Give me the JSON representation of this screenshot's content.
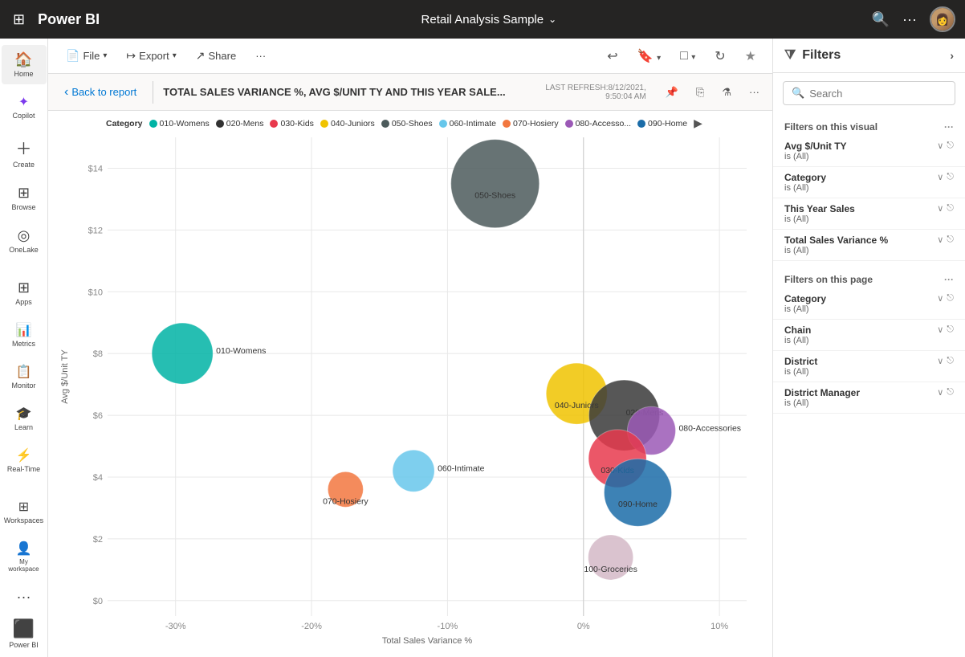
{
  "app": {
    "name": "Power BI",
    "grid_icon": "⊞",
    "nav_search_icon": "🔍",
    "nav_more_icon": "···"
  },
  "header": {
    "report_title": "Retail Analysis Sample",
    "chevron": "⌄",
    "last_refresh_label": "LAST REFRESH:8/12/2021,",
    "last_refresh_time": "9:50:04 AM"
  },
  "toolbar": {
    "file_label": "File",
    "export_label": "Export",
    "share_label": "Share",
    "more_label": "···",
    "undo_icon": "↩",
    "bookmark_icon": "🔖",
    "view_icon": "□",
    "refresh_icon": "↻",
    "favorite_icon": "★"
  },
  "report_header": {
    "back_label": "Back to report",
    "back_icon": "‹",
    "visual_title": "TOTAL SALES VARIANCE %, AVG $/UNIT TY AND THIS YEAR SALE..."
  },
  "legend": {
    "category_label": "Category",
    "items": [
      {
        "id": "010-Womens",
        "label": "010-Womens",
        "color": "#00B3A4"
      },
      {
        "id": "020-Mens",
        "label": "020-Mens",
        "color": "#333333"
      },
      {
        "id": "030-Kids",
        "label": "030-Kids",
        "color": "#E8394D"
      },
      {
        "id": "040-Juniors",
        "label": "040-Juniors",
        "color": "#F0C300"
      },
      {
        "id": "050-Shoes",
        "label": "050-Shoes",
        "color": "#4C5B5C"
      },
      {
        "id": "060-Intimate",
        "label": "060-Intimate",
        "color": "#67C7EB"
      },
      {
        "id": "070-Hosiery",
        "label": "070-Hosiery",
        "color": "#F2773F"
      },
      {
        "id": "080-Accesso...",
        "label": "080-Accesso...",
        "color": "#8B5CF6"
      },
      {
        "id": "090-Home",
        "label": "090-Home",
        "color": "#1B6CA8"
      }
    ],
    "more_icon": "▶"
  },
  "chart": {
    "x_axis_label": "Total Sales Variance %",
    "y_axis_label": "Avg $/Unit TY",
    "x_ticks": [
      "-30%",
      "-20%",
      "-10%",
      "0%",
      "10%"
    ],
    "y_ticks": [
      "$0",
      "$2",
      "$4",
      "$6",
      "$8",
      "$10",
      "$12",
      "$14"
    ],
    "bubbles": [
      {
        "id": "010-Womens",
        "label": "010-Womens",
        "color": "#00B3A4",
        "cx_pct": 6,
        "cy_pct": 42,
        "r": 38
      },
      {
        "id": "020-Mens",
        "label": "020-Mens",
        "color": "#3C3C3C",
        "cx_pct": 76,
        "cy_pct": 47,
        "r": 44
      },
      {
        "id": "030-Kids",
        "label": "030-Kids",
        "color": "#E8394D",
        "cx_pct": 72,
        "cy_pct": 56,
        "r": 36
      },
      {
        "id": "040-Juniors",
        "label": "040-Juniors",
        "color": "#F0C300",
        "cx_pct": 63,
        "cy_pct": 48,
        "r": 40
      },
      {
        "id": "050-Shoes",
        "label": "050-Shoes",
        "color": "#4C5B5C",
        "cx_pct": 68,
        "cy_pct": 12,
        "r": 55
      },
      {
        "id": "060-Intimate",
        "label": "060-Intimate",
        "color": "#67C7EB",
        "cx_pct": 44,
        "cy_pct": 60,
        "r": 26
      },
      {
        "id": "070-Hosiery",
        "label": "070-Hosiery",
        "color": "#F2773F",
        "cx_pct": 36,
        "cy_pct": 63,
        "r": 22
      },
      {
        "id": "080-Accessories",
        "label": "080-Accessories",
        "color": "#9B59B6",
        "cx_pct": 82,
        "cy_pct": 52,
        "r": 30
      },
      {
        "id": "090-Home",
        "label": "090-Home",
        "color": "#1B6CA8",
        "cx_pct": 78,
        "cy_pct": 62,
        "r": 42
      },
      {
        "id": "100-Groceries",
        "label": "100-Groceries",
        "color": "#D4B8C7",
        "cx_pct": 76,
        "cy_pct": 76,
        "r": 28
      }
    ]
  },
  "filters_panel": {
    "title": "Filters",
    "title_icon": "⧩",
    "expand_icon": "›",
    "search_placeholder": "Search",
    "search_icon": "🔍",
    "sections": [
      {
        "id": "on-visual",
        "title": "Filters on this visual",
        "more_icon": "···",
        "items": [
          {
            "name": "Avg $/Unit TY",
            "value": "is (All)"
          },
          {
            "name": "Category",
            "value": "is (All)"
          },
          {
            "name": "This Year Sales",
            "value": "is (All)"
          },
          {
            "name": "Total Sales Variance %",
            "value": "is (All)"
          }
        ]
      },
      {
        "id": "on-page",
        "title": "Filters on this page",
        "more_icon": "···",
        "items": [
          {
            "name": "Category",
            "value": "is (All)"
          },
          {
            "name": "Chain",
            "value": "is (All)"
          },
          {
            "name": "District",
            "value": "is (All)"
          },
          {
            "name": "District Manager",
            "value": "is (All)"
          }
        ]
      }
    ]
  },
  "sidebar": {
    "items": [
      {
        "id": "home",
        "label": "Home",
        "icon": "🏠"
      },
      {
        "id": "copilot",
        "label": "Copilot",
        "icon": "✦"
      },
      {
        "id": "create",
        "label": "Create",
        "icon": "+"
      },
      {
        "id": "browse",
        "label": "Browse",
        "icon": "⊞"
      },
      {
        "id": "onelake",
        "label": "OneLake",
        "icon": "◎"
      },
      {
        "id": "apps",
        "label": "Apps",
        "icon": "⊞"
      },
      {
        "id": "metrics",
        "label": "Metrics",
        "icon": "📊"
      },
      {
        "id": "monitor",
        "label": "Monitor",
        "icon": "📋"
      },
      {
        "id": "learn",
        "label": "Learn",
        "icon": "🎓"
      },
      {
        "id": "realtime",
        "label": "Real-Time",
        "icon": "⚡"
      },
      {
        "id": "workspaces",
        "label": "Workspaces",
        "icon": "⊞"
      },
      {
        "id": "myworkspace",
        "label": "My workspace",
        "icon": "👤"
      },
      {
        "id": "more",
        "label": "···",
        "icon": "···"
      }
    ]
  }
}
